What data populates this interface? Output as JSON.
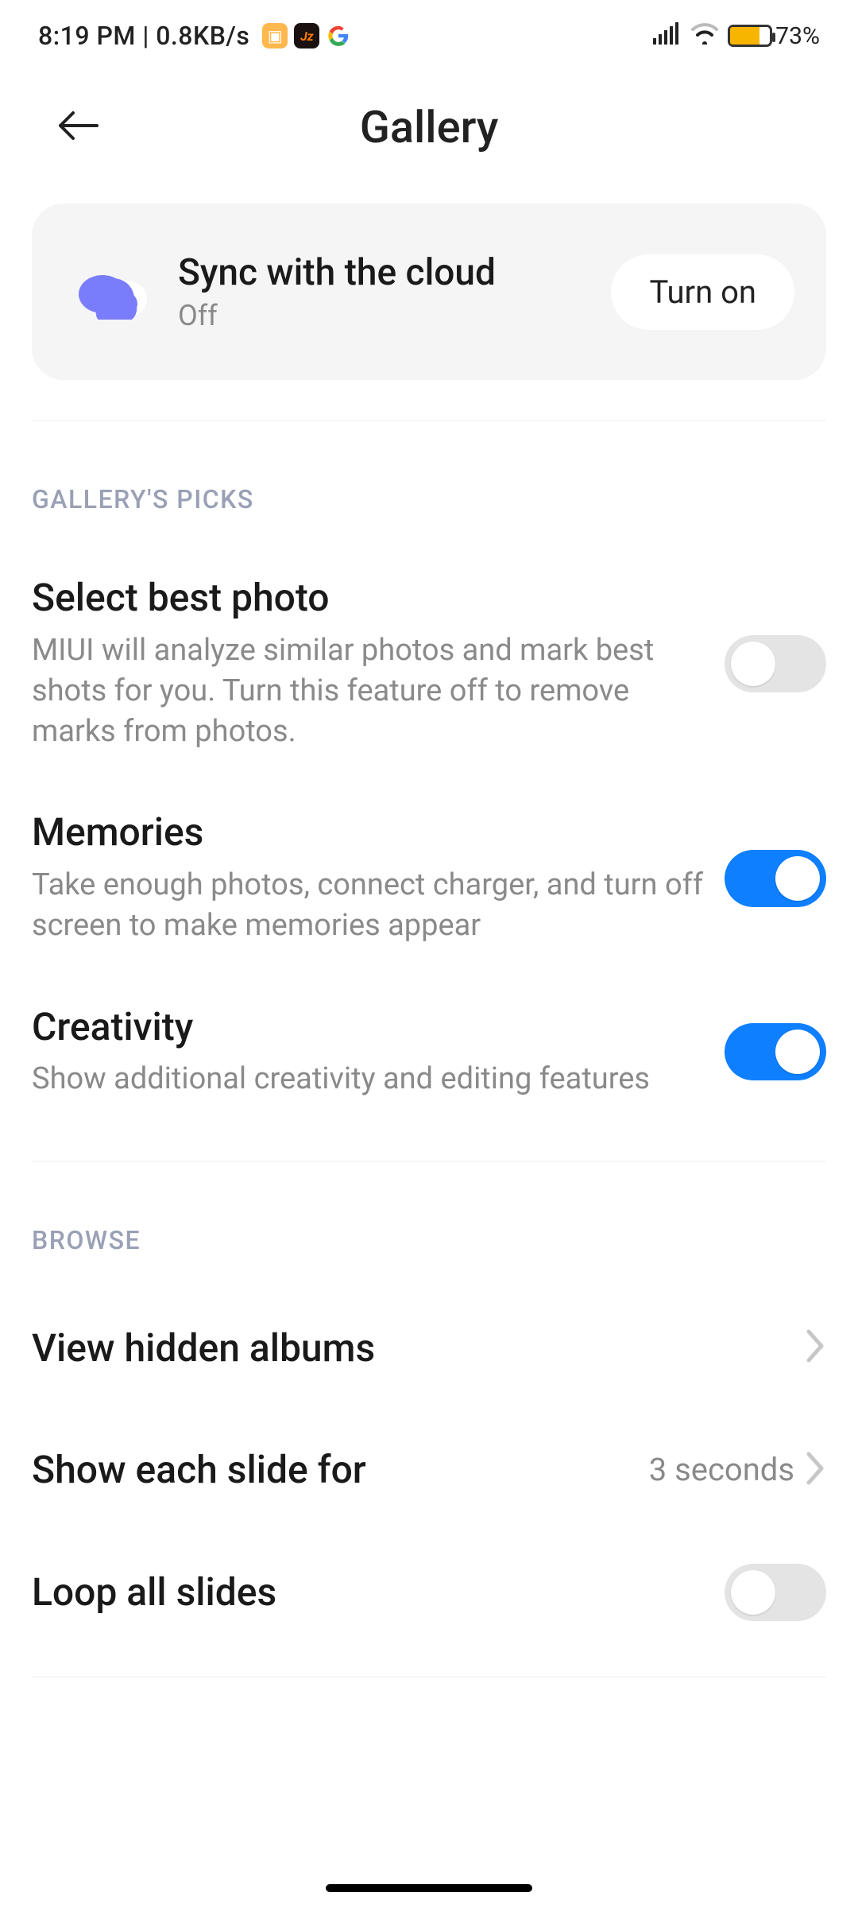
{
  "status": {
    "time": "8:19 PM",
    "net_speed": "0.8KB/s",
    "battery_pct": "73%"
  },
  "header": {
    "title": "Gallery"
  },
  "sync": {
    "title": "Sync with the cloud",
    "status": "Off",
    "button_label": "Turn on"
  },
  "sections": {
    "picks": {
      "header": "GALLERY'S PICKS",
      "best_photo": {
        "title": "Select best photo",
        "desc": "MIUI will analyze similar photos and mark best shots for you. Turn this feature off to remove marks from photos.",
        "enabled": false
      },
      "memories": {
        "title": "Memories",
        "desc": "Take enough photos, connect charger, and turn off screen to make memories appear",
        "enabled": true
      },
      "creativity": {
        "title": "Creativity",
        "desc": "Show additional creativity and editing features",
        "enabled": true
      }
    },
    "browse": {
      "header": "BROWSE",
      "hidden_albums": {
        "title": "View hidden albums"
      },
      "slideshow_duration": {
        "title": "Show each slide for",
        "value": "3 seconds"
      },
      "loop_slides": {
        "title": "Loop all slides",
        "enabled": false
      }
    }
  }
}
